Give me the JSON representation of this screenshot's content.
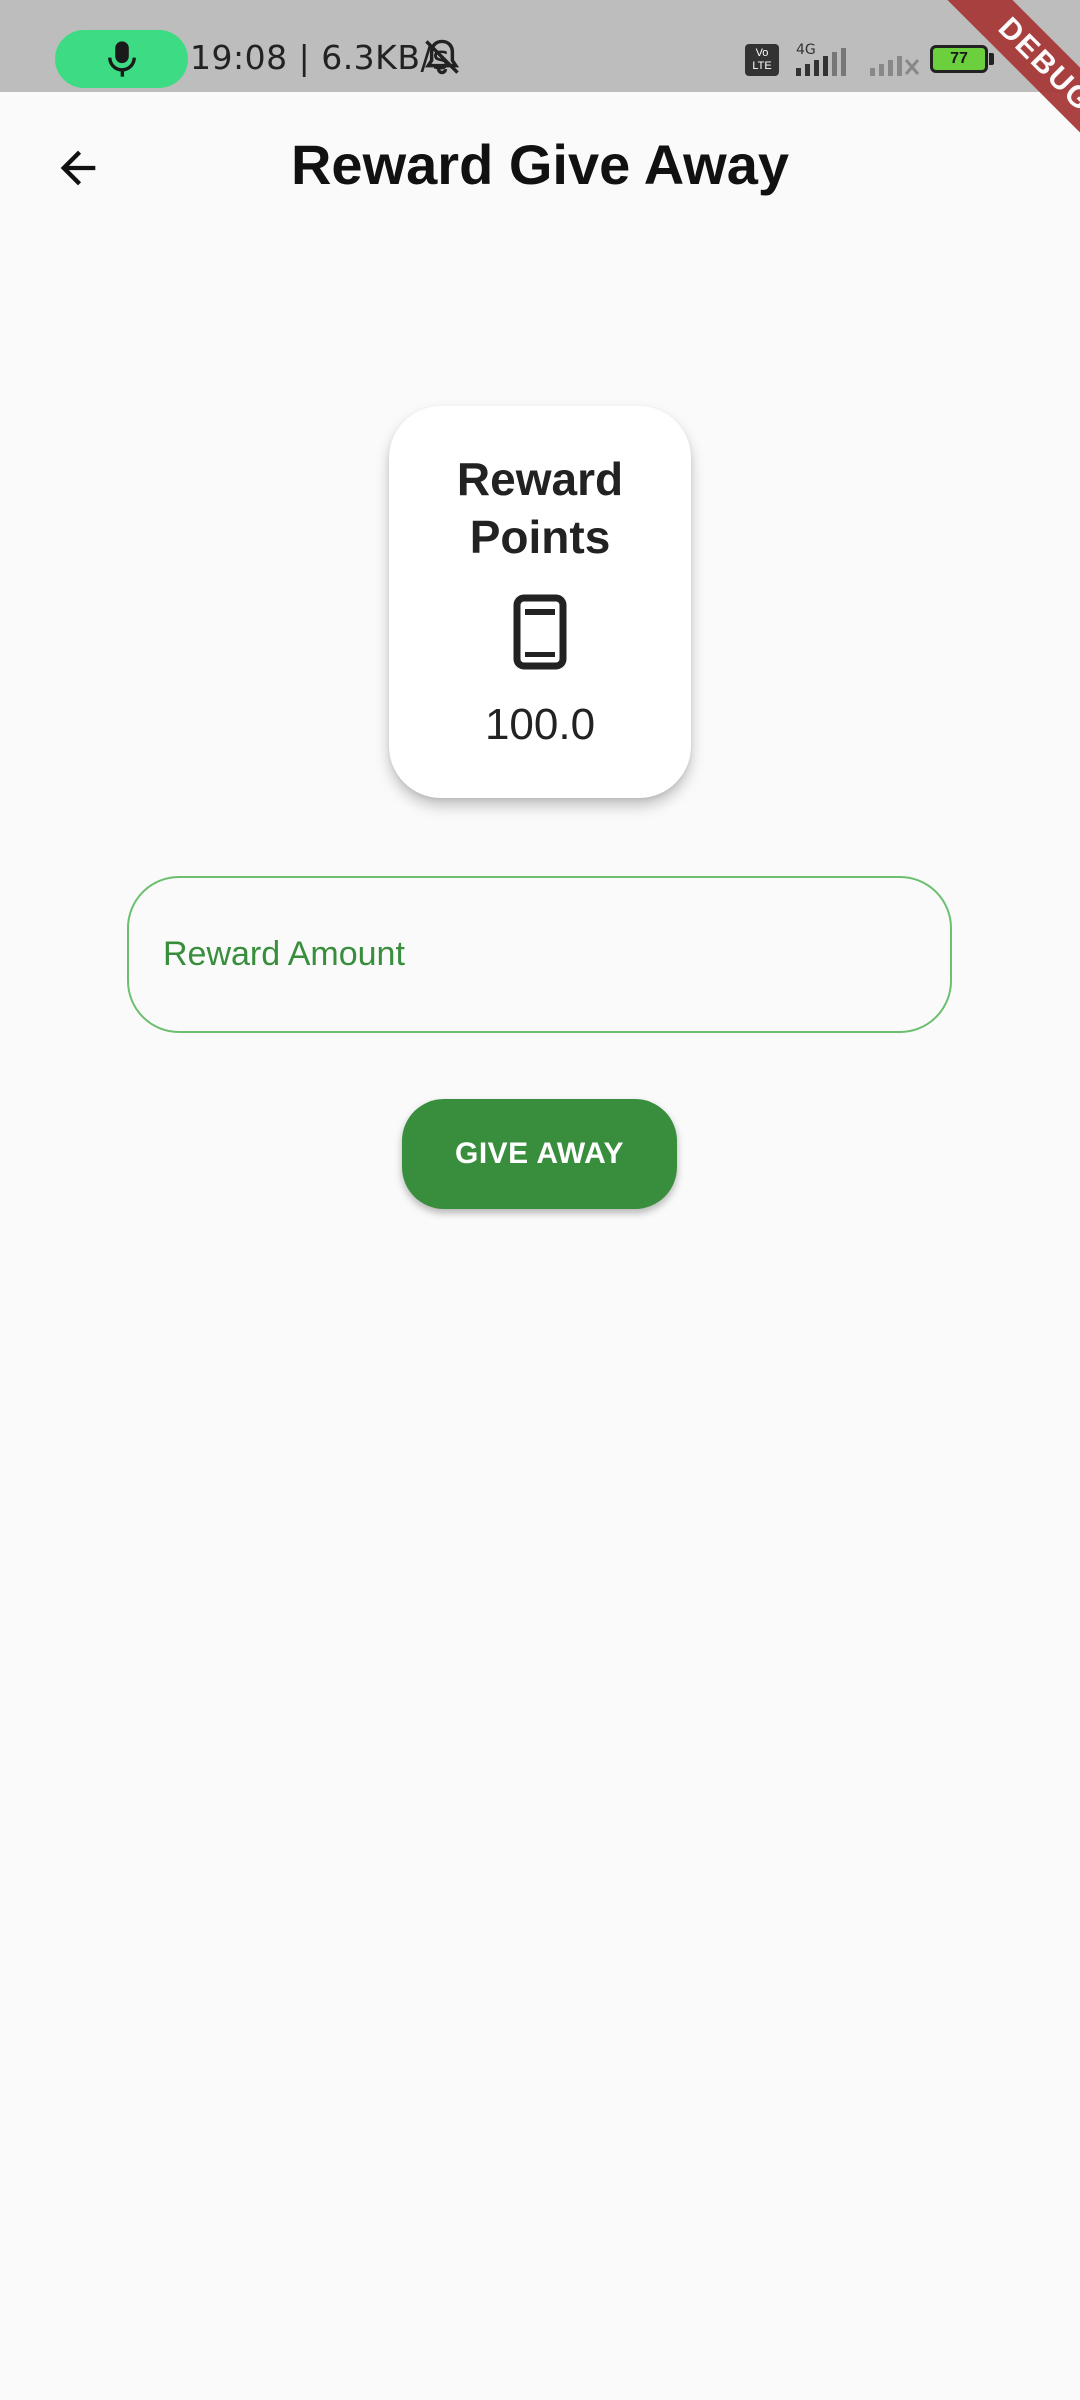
{
  "status_bar": {
    "time_speed": "19:08 | 6.3KB/s",
    "volte": "Vo\nLTE",
    "network": "4G",
    "battery": "77",
    "icons": [
      "mic-icon",
      "bell-off-icon",
      "signal-icon",
      "battery-icon"
    ]
  },
  "debug_banner": "DEBUG",
  "app_bar": {
    "title": "Reward Give Away",
    "back_icon": "arrow-back-icon"
  },
  "reward_card": {
    "title": "Reward Points",
    "icon": "phone-icon",
    "value": "100.0"
  },
  "form": {
    "reward_amount_placeholder": "Reward Amount",
    "reward_amount_value": ""
  },
  "actions": {
    "give_away_label": "GIVE AWAY"
  },
  "colors": {
    "accent_green": "#388e3c",
    "input_border": "#6bbf6f",
    "background": "#fafafa",
    "status_bar_bg": "#bdbdbd",
    "mic_pill": "#3ddc84",
    "debug_ribbon": "#a83a3a"
  }
}
